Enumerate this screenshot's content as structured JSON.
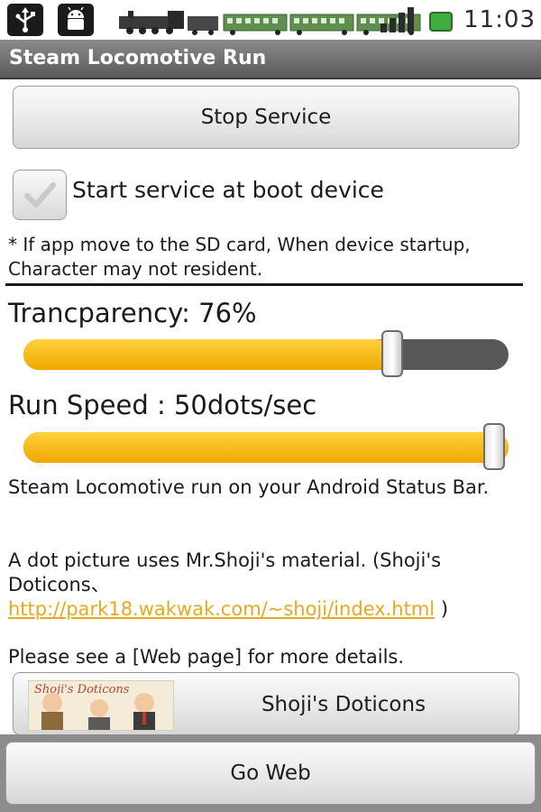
{
  "status_bar": {
    "usb_icon": "usb-icon",
    "debug_icon": "android-debug-icon",
    "clock": "11:03",
    "train": "steam-locomotive-train"
  },
  "title_bar": {
    "title": "Steam Locomotive Run"
  },
  "service": {
    "stop_label": "Stop Service",
    "boot_checkbox_label": "Start service at boot device",
    "boot_checked": false,
    "note": "* If app move to the SD card, When device startup, Character may not resident."
  },
  "transparency": {
    "label": "Trancparency: 76%",
    "value_percent": 76
  },
  "run_speed": {
    "label": "Run Speed : 50dots/sec",
    "value_fraction": 1.0
  },
  "info": {
    "description": "Steam Locomotive run on your Android Status Bar.",
    "credit_prefix": "A dot picture uses Mr.Shoji's material. (Shoji's Doticons、 ",
    "credit_link": "http://park18.wakwak.com/~shoji/index.html",
    "credit_suffix": " )",
    "see_web": "Please see a [Web page] for more details."
  },
  "buttons": {
    "shoji_label": "Shoji's Doticons",
    "shoji_image_text": "Shoji's Doticons",
    "goweb_label": "Go Web"
  },
  "colors": {
    "accent_yellow": "#f7b500",
    "link": "#e6a91c",
    "track": "#575757",
    "title_bar": "#6b6b6b"
  }
}
